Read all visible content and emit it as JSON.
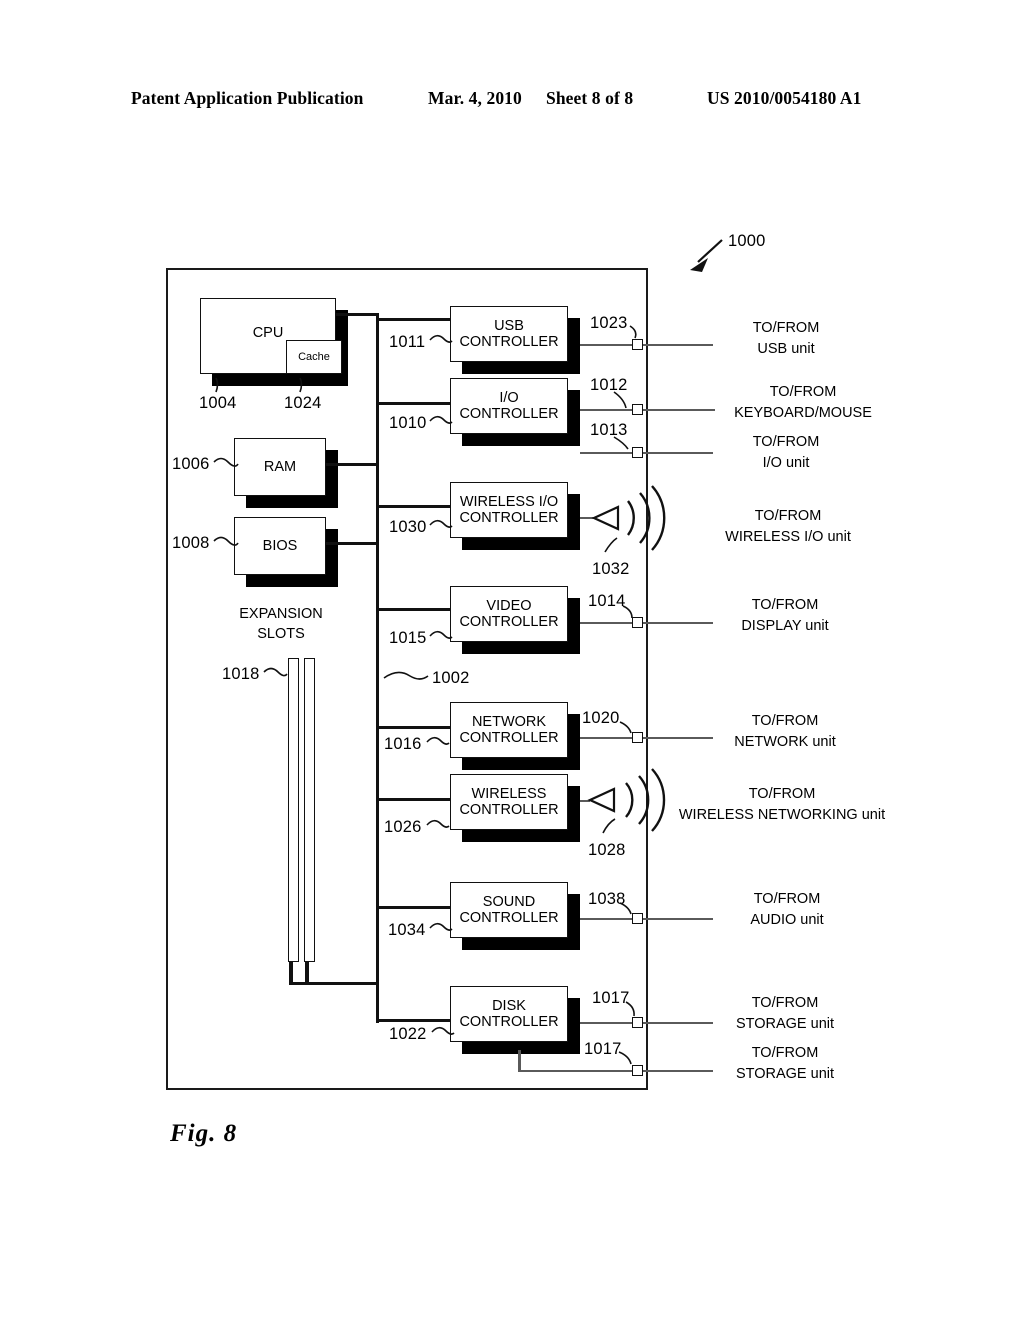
{
  "header": {
    "publication": "Patent Application Publication",
    "date": "Mar. 4, 2010",
    "sheet": "Sheet 8 of 8",
    "number": "US 2010/0054180 A1"
  },
  "figure": {
    "caption": "Fig. 8",
    "system_ref": "1000",
    "bus_ref": "1002"
  },
  "core": {
    "cpu_label": "CPU",
    "cache_label": "Cache",
    "cpu_ref": "1004",
    "cache_ref": "1024",
    "ram_label": "RAM",
    "ram_ref": "1006",
    "bios_label": "BIOS",
    "bios_ref": "1008",
    "expansion_label_line1": "EXPANSION",
    "expansion_label_line2": "SLOTS",
    "expansion_ref": "1018"
  },
  "controllers": [
    {
      "name": "usb",
      "line1": "USB",
      "line2": "CONTROLLER",
      "ref": "1011"
    },
    {
      "name": "io",
      "line1": "I/O",
      "line2": "CONTROLLER",
      "ref": "1010"
    },
    {
      "name": "wireless-io",
      "line1": "WIRELESS I/O",
      "line2": "CONTROLLER",
      "ref": "1030"
    },
    {
      "name": "video",
      "line1": "VIDEO",
      "line2": "CONTROLLER",
      "ref": "1015"
    },
    {
      "name": "network",
      "line1": "NETWORK",
      "line2": "CONTROLLER",
      "ref": "1016"
    },
    {
      "name": "wireless",
      "line1": "WIRELESS",
      "line2": "CONTROLLER",
      "ref": "1026"
    },
    {
      "name": "sound",
      "line1": "SOUND",
      "line2": "CONTROLLER",
      "ref": "1034"
    },
    {
      "name": "disk",
      "line1": "DISK",
      "line2": "CONTROLLER",
      "ref": "1022"
    }
  ],
  "ports": [
    {
      "name": "usb",
      "ref": "1023",
      "line1": "TO/FROM",
      "line2": "USB unit"
    },
    {
      "name": "keyboard",
      "ref": "1012",
      "line1": "TO/FROM",
      "line2": "KEYBOARD/MOUSE"
    },
    {
      "name": "io",
      "ref": "1013",
      "line1": "TO/FROM",
      "line2": "I/O unit"
    },
    {
      "name": "wireless-io",
      "ref": "1032",
      "line1": "TO/FROM",
      "line2": "WIRELESS I/O unit"
    },
    {
      "name": "display",
      "ref": "1014",
      "line1": "TO/FROM",
      "line2": "DISPLAY unit"
    },
    {
      "name": "network",
      "ref": "1020",
      "line1": "TO/FROM",
      "line2": "NETWORK unit"
    },
    {
      "name": "wireless-net",
      "ref": "1028",
      "line1": "TO/FROM",
      "line2": "WIRELESS NETWORKING unit"
    },
    {
      "name": "audio",
      "ref": "1038",
      "line1": "TO/FROM",
      "line2": "AUDIO unit"
    },
    {
      "name": "storage-1",
      "ref": "1017",
      "line1": "TO/FROM",
      "line2": "STORAGE unit"
    },
    {
      "name": "storage-2",
      "ref": "1017",
      "line1": "TO/FROM",
      "line2": "STORAGE unit"
    }
  ]
}
